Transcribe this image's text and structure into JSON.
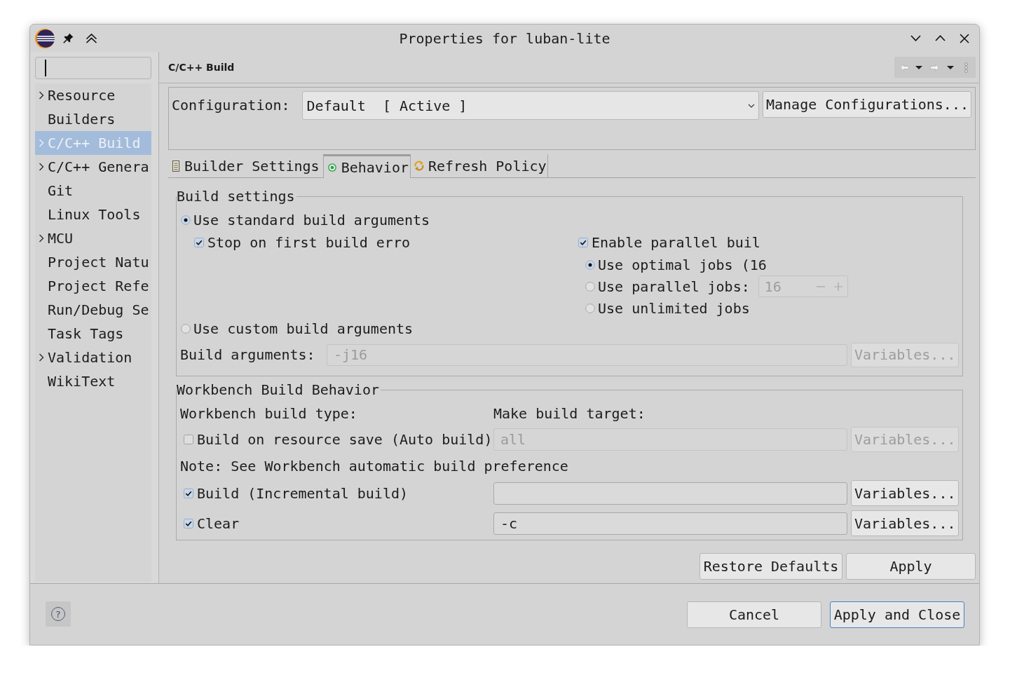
{
  "window": {
    "title": "Properties for luban-lite"
  },
  "sidebar": {
    "items": [
      {
        "label": "Resource",
        "expandable": true,
        "selected": false
      },
      {
        "label": "Builders",
        "expandable": false,
        "selected": false
      },
      {
        "label": "C/C++ Build",
        "expandable": true,
        "selected": true
      },
      {
        "label": "C/C++ Genera",
        "expandable": true,
        "selected": false
      },
      {
        "label": "Git",
        "expandable": false,
        "selected": false
      },
      {
        "label": "Linux Tools",
        "expandable": false,
        "selected": false
      },
      {
        "label": "MCU",
        "expandable": true,
        "selected": false
      },
      {
        "label": "Project Natu",
        "expandable": false,
        "selected": false
      },
      {
        "label": "Project Refe",
        "expandable": false,
        "selected": false
      },
      {
        "label": "Run/Debug Se",
        "expandable": false,
        "selected": false
      },
      {
        "label": "Task Tags",
        "expandable": false,
        "selected": false
      },
      {
        "label": "Validation",
        "expandable": true,
        "selected": false
      },
      {
        "label": "WikiText",
        "expandable": false,
        "selected": false
      }
    ]
  },
  "page": {
    "title": "C/C++ Build"
  },
  "configuration": {
    "label": "Configuration:",
    "value": "Default  [ Active ]",
    "button": "Manage Configurations..."
  },
  "tabs": [
    {
      "label": "Builder Settings",
      "selected": false
    },
    {
      "label": "Behavior",
      "selected": true
    },
    {
      "label": "Refresh Policy",
      "selected": false
    }
  ],
  "build_settings": {
    "legend": "Build settings",
    "standard": {
      "label": "Use standard build arguments",
      "selected": true
    },
    "stop_on_error": {
      "label": "Stop on first build erro",
      "checked": true
    },
    "parallel": {
      "label": "Enable parallel buil",
      "checked": true,
      "options": [
        {
          "label": "Use optimal jobs (16",
          "selected": true
        },
        {
          "label": "Use parallel jobs:",
          "selected": false,
          "spinner": {
            "value": "16",
            "disabled": true
          }
        },
        {
          "label": "Use unlimited jobs",
          "selected": false
        }
      ]
    },
    "custom": {
      "label": "Use custom build arguments",
      "selected": false
    },
    "arguments": {
      "label": "Build arguments:",
      "value": "-j16",
      "disabled": true,
      "button": "Variables..."
    }
  },
  "workbench": {
    "legend": "Workbench Build Behavior",
    "type_label": "Workbench build type:",
    "target_label": "Make build target:",
    "rows": [
      {
        "kind": "build",
        "label": "Build on resource save (Auto build)",
        "checked": false,
        "target": "all",
        "button": "Variables..."
      },
      {
        "kind": "note",
        "text": "Note: See Workbench automatic build preference"
      },
      {
        "kind": "build",
        "label": "Build (Incremental build)",
        "checked": true,
        "button": "Variables..."
      },
      {
        "kind": "build",
        "label": "Clear",
        "checked": true,
        "target": "-c",
        "button": "Variables..."
      }
    ]
  },
  "page_buttons": [
    "Restore Defaults",
    "Apply"
  ],
  "footer": {
    "help": "?",
    "buttons": [
      {
        "label": "Cancel",
        "default": false
      },
      {
        "label": "Apply and Close",
        "default": true
      }
    ]
  }
}
